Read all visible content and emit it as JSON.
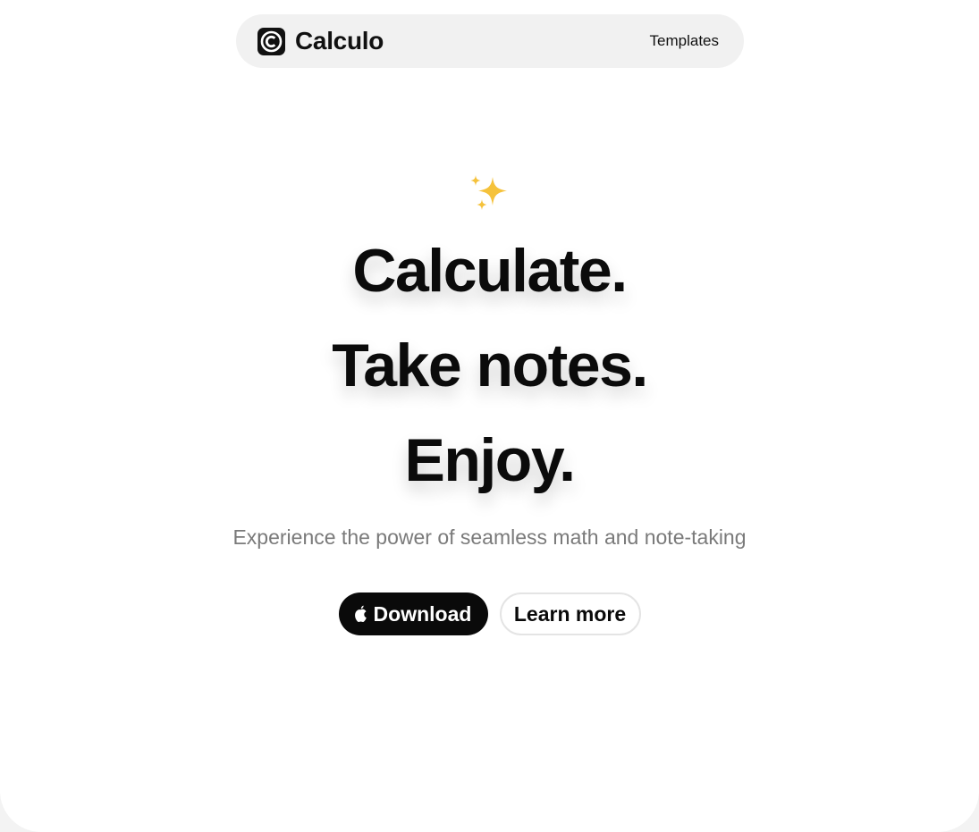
{
  "navbar": {
    "brand": "Calculo",
    "links": [
      {
        "label": "Templates"
      }
    ]
  },
  "hero": {
    "icon": "sparkles-icon",
    "headlines": [
      "Calculate.",
      "Take notes.",
      "Enjoy."
    ],
    "subtitle": "Experience the power of seamless math and note-taking",
    "primary_button": {
      "label": "Download",
      "icon": "apple-icon"
    },
    "secondary_button": {
      "label": "Learn more"
    }
  },
  "colors": {
    "background": "#ffffff",
    "navbar_bg": "#f1f1f1",
    "text": "#0b0b0b",
    "subtitle": "#7a7a7a",
    "primary_button_bg": "#0a0a0a",
    "sparkle": "#f5c23b"
  }
}
